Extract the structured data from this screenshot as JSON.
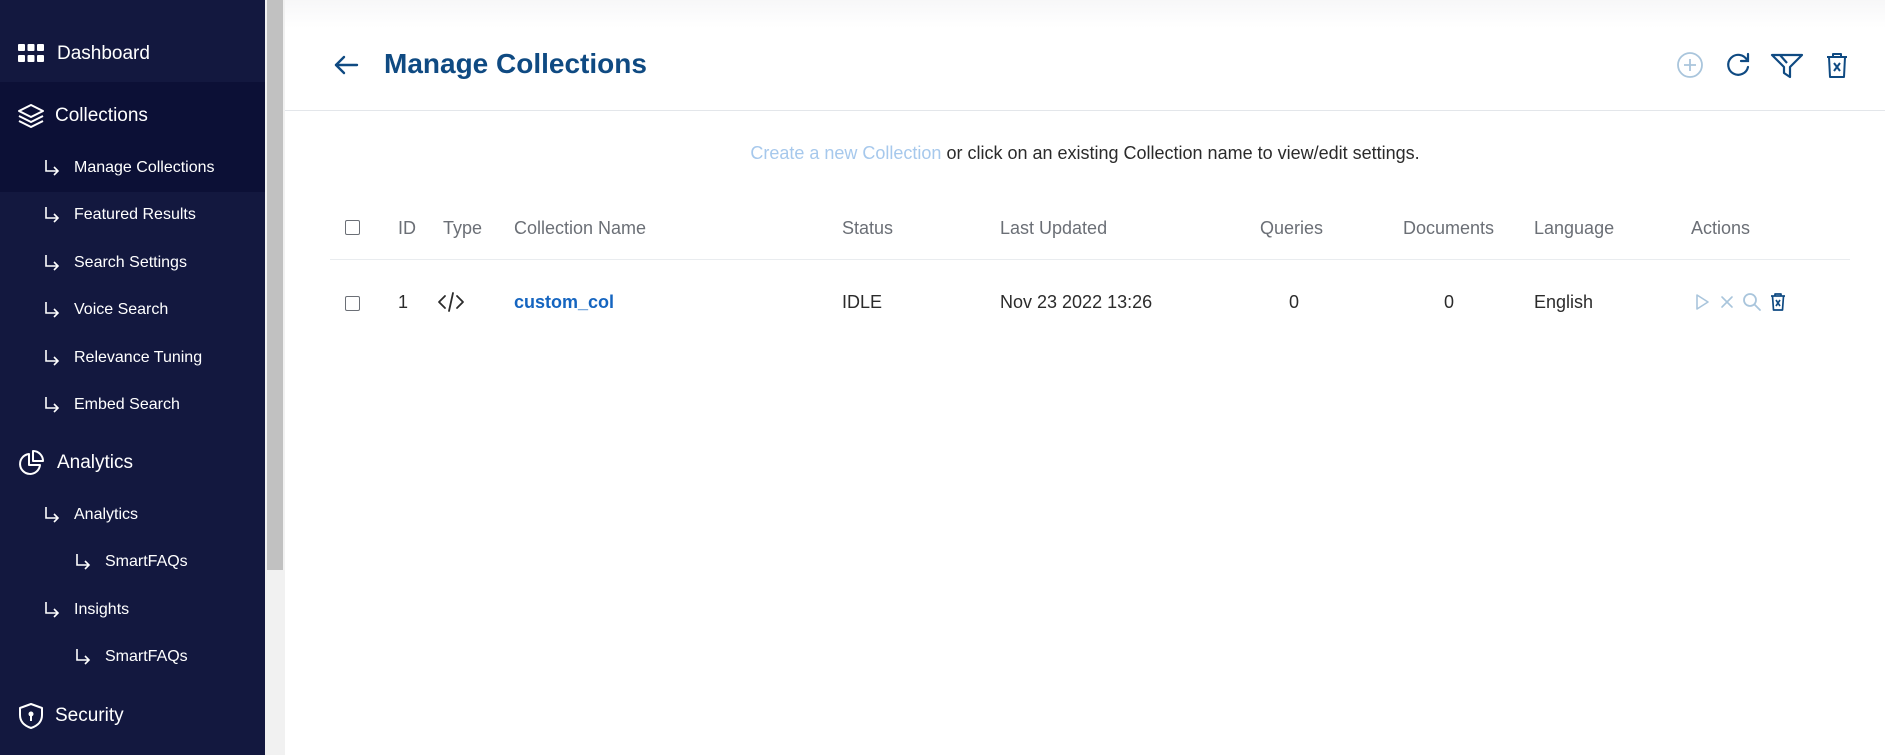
{
  "sidebar": {
    "dashboard": {
      "label": "Dashboard",
      "icon": "grid-icon"
    },
    "collections": {
      "label": "Collections",
      "icon": "layers-icon",
      "items": [
        {
          "label": "Manage Collections"
        },
        {
          "label": "Featured Results"
        },
        {
          "label": "Search Settings"
        },
        {
          "label": "Voice Search"
        },
        {
          "label": "Relevance Tuning"
        },
        {
          "label": "Embed Search"
        }
      ]
    },
    "analytics": {
      "label": "Analytics",
      "icon": "pie-chart-icon",
      "items": [
        {
          "label": "Analytics"
        },
        {
          "label": "SmartFAQs"
        },
        {
          "label": "Insights"
        },
        {
          "label": "SmartFAQs"
        }
      ]
    },
    "security": {
      "label": "Security",
      "icon": "shield-icon"
    }
  },
  "header": {
    "title": "Manage Collections",
    "tools": [
      "add-circle-icon",
      "refresh-icon",
      "filter-icon",
      "delete-icon"
    ]
  },
  "hint": {
    "link": "Create a new Collection",
    "text": " or click on an existing Collection name to view/edit settings."
  },
  "table": {
    "headers": {
      "id": "ID",
      "type": "Type",
      "name": "Collection Name",
      "status": "Status",
      "updated": "Last Updated",
      "queries": "Queries",
      "documents": "Documents",
      "language": "Language",
      "actions": "Actions"
    },
    "rows": [
      {
        "id": "1",
        "type_icon": "code-icon",
        "name": "custom_col",
        "status": "IDLE",
        "updated": "Nov 23 2022 13:26",
        "queries": "0",
        "documents": "0",
        "language": "English"
      }
    ]
  },
  "colors": {
    "sidebar_bg": "#13183f",
    "title": "#0f4a82",
    "link": "#1565c0",
    "hint_link": "#a6c8ec"
  }
}
